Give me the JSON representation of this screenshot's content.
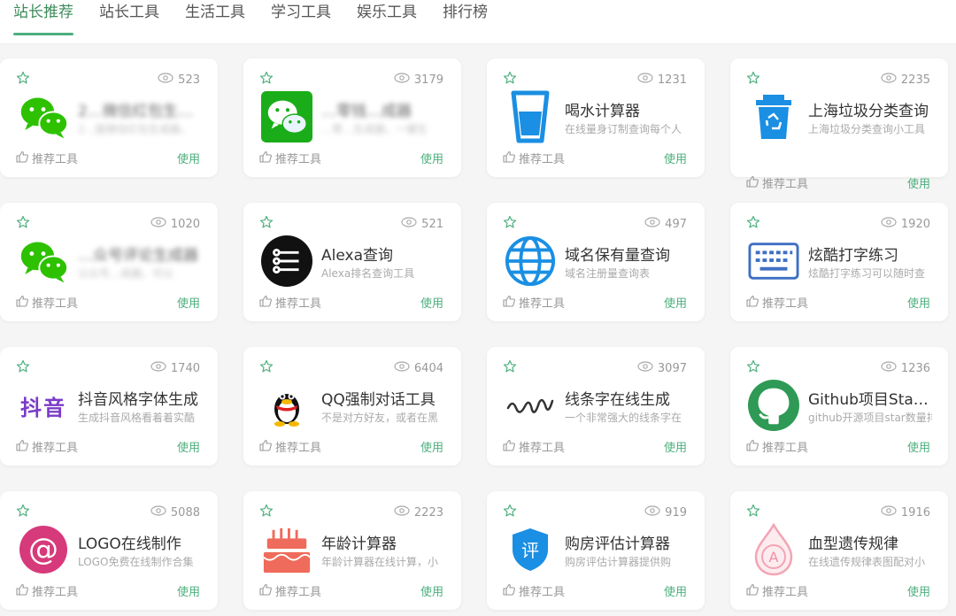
{
  "tabs": [
    "站长推荐",
    "站长工具",
    "生活工具",
    "学习工具",
    "娱乐工具",
    "排行榜"
  ],
  "active_tab": 0,
  "card_common": {
    "recommend_label": "推荐工具",
    "use_label": "使用"
  },
  "cards": [
    {
      "views": "523",
      "title": "2…微信红包生…",
      "desc": "2…版微信红包生成器，",
      "icon": "wechat-icon"
    },
    {
      "views": "3179",
      "title": "…零钱…成器",
      "desc": "…零…生成器，一键生",
      "icon": "wechat-app-icon"
    },
    {
      "views": "1231",
      "title": "喝水计算器",
      "desc": "在线量身订制查询每个人",
      "icon": "water-cup-icon"
    },
    {
      "views": "2235",
      "title": "上海垃圾分类查询",
      "desc": "上海垃圾分类查询小工具",
      "icon": "recycle-bin-icon"
    },
    {
      "views": "1020",
      "title": "…众号评论生成器",
      "desc": "公众号…成器，可以",
      "icon": "wechat-icon"
    },
    {
      "views": "521",
      "title": "Alexa查询",
      "desc": "Alexa排名查询工具",
      "icon": "alexa-icon"
    },
    {
      "views": "497",
      "title": "域名保有量查询",
      "desc": "域名注册量查询表",
      "icon": "globe-icon"
    },
    {
      "views": "1920",
      "title": "炫酷打字练习",
      "desc": "炫酷打字练习可以随时查",
      "icon": "keyboard-icon"
    },
    {
      "views": "1740",
      "title": "抖音风格字体生成",
      "desc": "生成抖音风格看着着实酷",
      "icon": "douyin-text-icon",
      "icon_text": "抖音"
    },
    {
      "views": "6404",
      "title": "QQ强制对话工具",
      "desc": "不是对方好友，或者在黑",
      "icon": "qq-penguin-icon"
    },
    {
      "views": "3097",
      "title": "线条字在线生成",
      "desc": "一个非常强大的线条字在",
      "icon": "line-text-icon"
    },
    {
      "views": "1236",
      "title": "Github项目Star…",
      "desc": "github开源项目star数量排",
      "icon": "github-icon"
    },
    {
      "views": "5088",
      "title": "LOGO在线制作",
      "desc": "LOGO免费在线制作合集",
      "icon": "at-logo-icon",
      "icon_text": "@"
    },
    {
      "views": "2223",
      "title": "年龄计算器",
      "desc": "年龄计算器在线计算，小",
      "icon": "cake-icon"
    },
    {
      "views": "919",
      "title": "购房评估计算器",
      "desc": "购房评估计算器提供购",
      "icon": "shield-ping-icon",
      "icon_text": "评"
    },
    {
      "views": "1916",
      "title": "血型遗传规律",
      "desc": "在线遗传规律表图配对小",
      "icon": "blood-drop-icon",
      "icon_text": "A"
    }
  ],
  "colors": {
    "accent": "#4caf7d",
    "tab_active": "#3d8b5a"
  }
}
